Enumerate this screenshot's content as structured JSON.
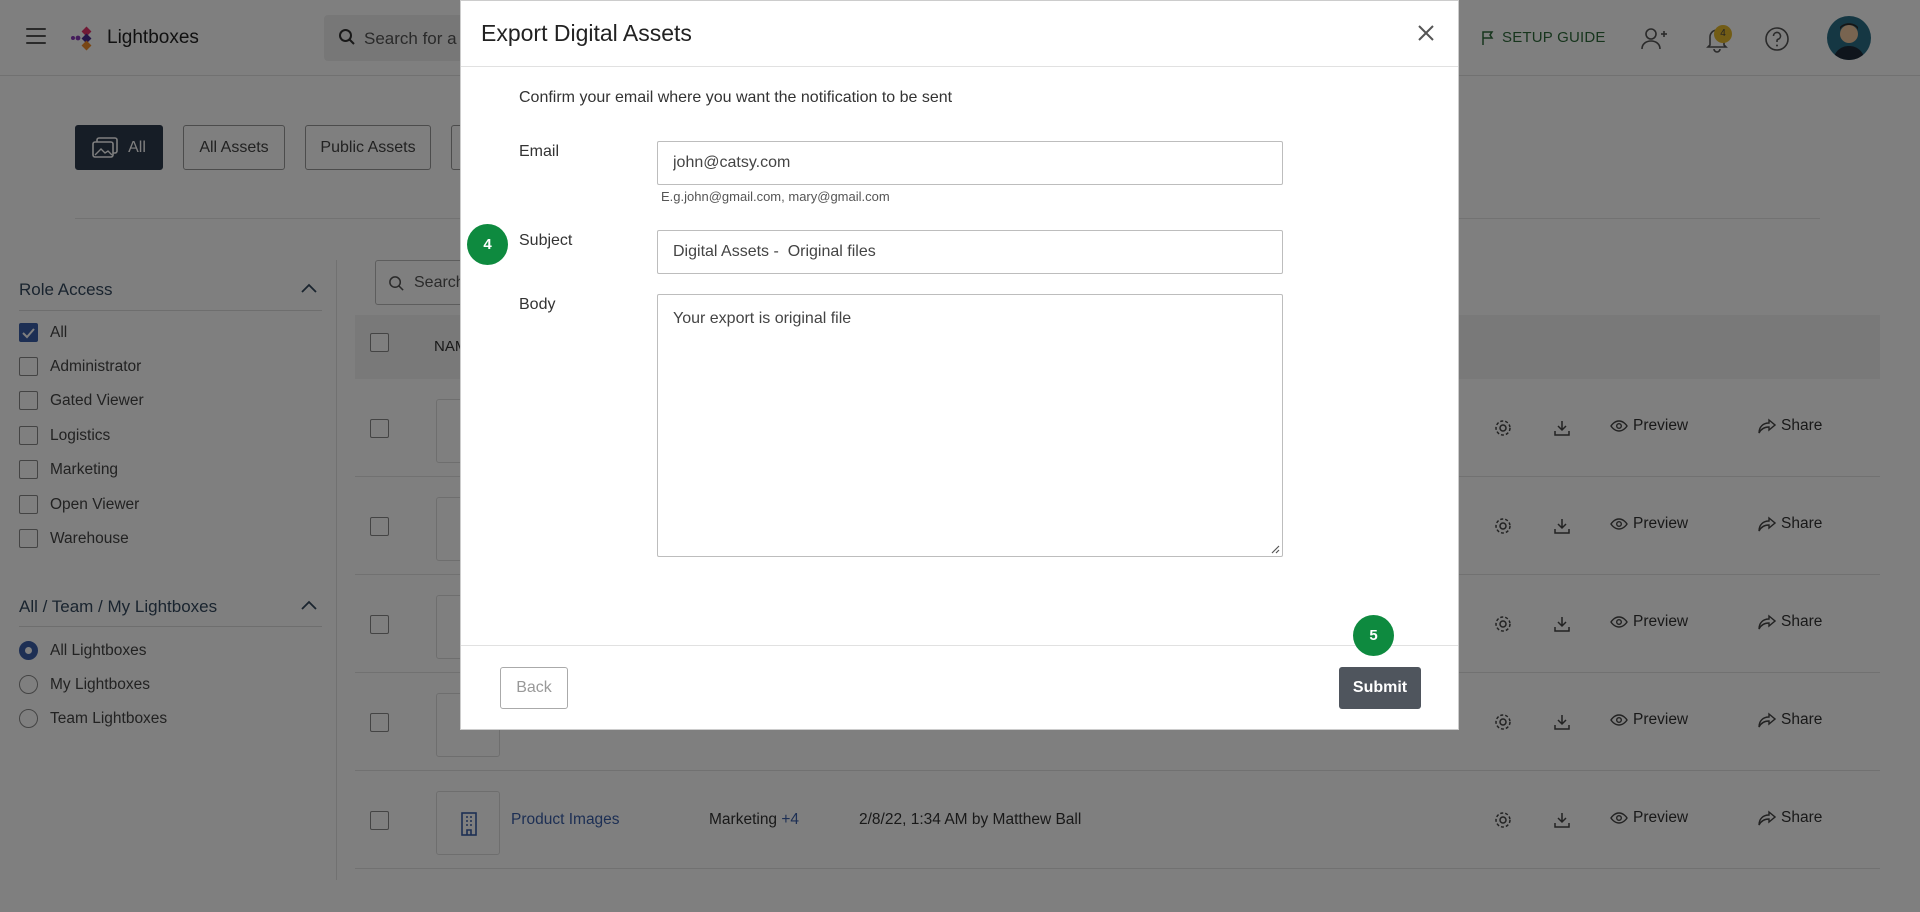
{
  "header": {
    "app_title": "Lightboxes",
    "search_placeholder": "Search for a",
    "setup_guide": "SETUP GUIDE",
    "notification_count": "4"
  },
  "tabs": [
    {
      "label": "All",
      "active": true
    },
    {
      "label": "All Assets"
    },
    {
      "label": "Public Assets"
    }
  ],
  "sidebar": {
    "role_access": {
      "title": "Role Access",
      "items": [
        {
          "label": "All",
          "checked": true
        },
        {
          "label": "Administrator"
        },
        {
          "label": "Gated Viewer"
        },
        {
          "label": "Logistics"
        },
        {
          "label": "Marketing"
        },
        {
          "label": "Open Viewer"
        },
        {
          "label": "Warehouse"
        }
      ]
    },
    "ownership": {
      "title": "All / Team / My Lightboxes",
      "items": [
        {
          "label": "All Lightboxes",
          "selected": true
        },
        {
          "label": "My Lightboxes"
        },
        {
          "label": "Team Lightboxes"
        }
      ]
    }
  },
  "list": {
    "search_placeholder": "Search",
    "name_header": "NAM",
    "actions": {
      "preview": "Preview",
      "share": "Share"
    },
    "last_row": {
      "name": "Product Images",
      "role": "Marketing",
      "role_more": "+4",
      "date": "2/8/22, 1:34 AM by Matthew Ball"
    }
  },
  "modal": {
    "title": "Export Digital Assets",
    "confirm_text": "Confirm your email where you want the notification to be sent",
    "email_label": "Email",
    "email_value": "john@catsy.com",
    "email_hint": "E.g.john@gmail.com, mary@gmail.com",
    "subject_label": "Subject",
    "subject_value": "Digital Assets -  Original files",
    "body_label": "Body",
    "body_value": "Your export is original file",
    "back_label": "Back",
    "submit_label": "Submit",
    "step_subject": "4",
    "step_submit": "5"
  },
  "colors": {
    "accent_blue": "#3a5fa8",
    "step_green": "#0e8a3f",
    "submit_gray": "#4f555d",
    "active_tab": "#2d3a4c"
  }
}
